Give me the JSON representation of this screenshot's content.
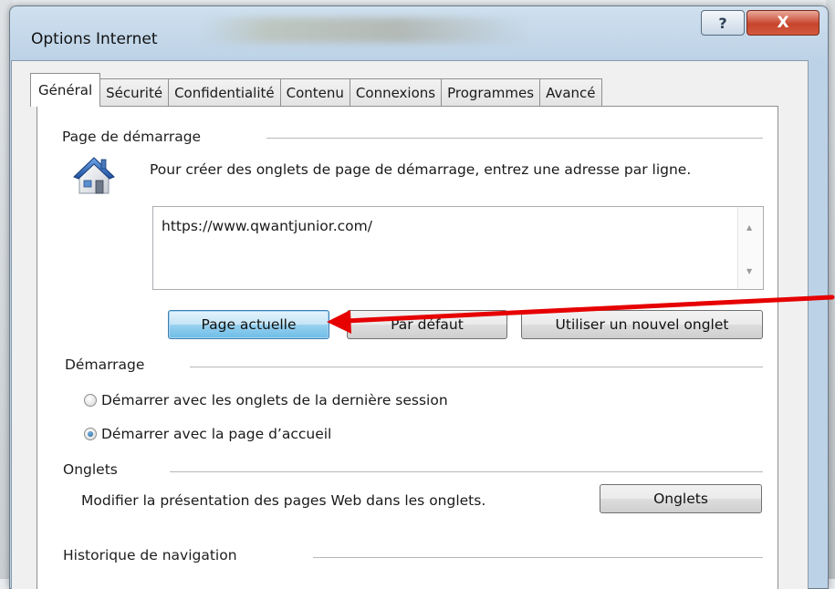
{
  "window": {
    "title": "Options Internet",
    "help_label": "?",
    "close_label": "X"
  },
  "tabs": [
    {
      "label": "Général",
      "active": true
    },
    {
      "label": "Sécurité"
    },
    {
      "label": "Confidentialité"
    },
    {
      "label": "Contenu"
    },
    {
      "label": "Connexions"
    },
    {
      "label": "Programmes"
    },
    {
      "label": "Avancé"
    }
  ],
  "homepage": {
    "section_title": "Page de démarrage",
    "description": "Pour créer des onglets de page de démarrage, entrez une adresse par ligne.",
    "url_value": "https://www.qwantjunior.com/",
    "btn_current": "Page actuelle",
    "btn_default": "Par défaut",
    "btn_new_tab": "Utiliser un nouvel onglet",
    "icon": "house-icon"
  },
  "startup": {
    "section_title": "Démarrage",
    "option_last_session": "Démarrer avec les onglets de la dernière session",
    "option_home_page": "Démarrer avec la page d’accueil",
    "selected": "home_page"
  },
  "tabs_section": {
    "section_title": "Onglets",
    "description": "Modifier la présentation des pages Web dans les onglets.",
    "btn_tabs": "Onglets"
  },
  "history": {
    "section_title": "Historique de navigation"
  },
  "annotation": {
    "arrow_color": "#e60000"
  }
}
